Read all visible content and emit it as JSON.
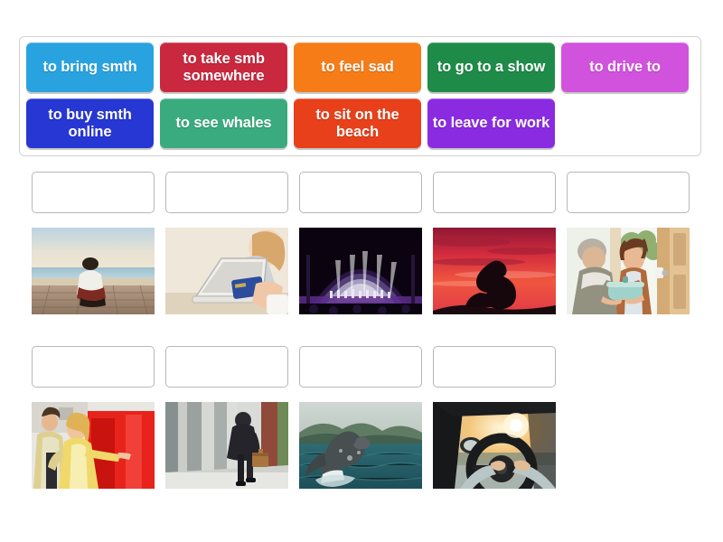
{
  "activity": {
    "type": "match-up-drag-and-drop",
    "background_color": "#ffffff"
  },
  "wordbank": {
    "panel_border_color": "#d2d2d2",
    "rows": [
      [
        {
          "label": "to bring smth",
          "color": "#29a3e0",
          "name": "tile-to-bring-smth"
        },
        {
          "label": "to take smb somewhere",
          "color": "#c9283e",
          "name": "tile-to-take-smb-somewhere"
        },
        {
          "label": "to feel sad",
          "color": "#f57c17",
          "name": "tile-to-feel-sad"
        },
        {
          "label": "to go to a show",
          "color": "#1e8b49",
          "name": "tile-to-go-to-a-show"
        },
        {
          "label": "to drive to",
          "color": "#d152dd",
          "name": "tile-to-drive-to"
        }
      ],
      [
        {
          "label": "to buy smth online",
          "color": "#2737d4",
          "name": "tile-to-buy-smth-online"
        },
        {
          "label": "to see whales",
          "color": "#3aab7e",
          "name": "tile-to-see-whales"
        },
        {
          "label": "to sit on the beach",
          "color": "#e8401a",
          "name": "tile-to-sit-on-the-beach"
        },
        {
          "label": "to leave for work",
          "color": "#8a2be2",
          "name": "tile-to-leave-for-work"
        }
      ]
    ]
  },
  "answer_grid": {
    "dropzone_border_color": "#b7b7b7",
    "row1": {
      "dropzones": [
        {
          "name": "dropzone-1",
          "value": ""
        },
        {
          "name": "dropzone-2",
          "value": ""
        },
        {
          "name": "dropzone-3",
          "value": ""
        },
        {
          "name": "dropzone-4",
          "value": ""
        },
        {
          "name": "dropzone-5",
          "value": ""
        }
      ],
      "images": [
        {
          "name": "image-man-sitting-on-beach",
          "alt": "man sitting on boardwalk facing the sea"
        },
        {
          "name": "image-laptop-credit-card",
          "alt": "woman shopping online with laptop and credit card"
        },
        {
          "name": "image-concert-stage",
          "alt": "lit concert stage with performers"
        },
        {
          "name": "image-sad-silhouette-sunset",
          "alt": "silhouette of sad person against red sunset"
        },
        {
          "name": "image-man-bringing-dish",
          "alt": "man bringing a covered dish to a woman at her door"
        }
      ]
    },
    "row2": {
      "dropzones": [
        {
          "name": "dropzone-6",
          "value": ""
        },
        {
          "name": "dropzone-7",
          "value": ""
        },
        {
          "name": "dropzone-8",
          "value": ""
        },
        {
          "name": "dropzone-9",
          "value": ""
        }
      ],
      "images": [
        {
          "name": "image-couple-pointing",
          "alt": "couple in yellow coats pointing at a red building"
        },
        {
          "name": "image-businessman-walking",
          "alt": "businessman with briefcase walking away down a street"
        },
        {
          "name": "image-breaching-whale",
          "alt": "humpback whale breaching the ocean surface"
        },
        {
          "name": "image-driving-car",
          "alt": "driver hands on steering wheel facing the sun"
        }
      ]
    }
  }
}
